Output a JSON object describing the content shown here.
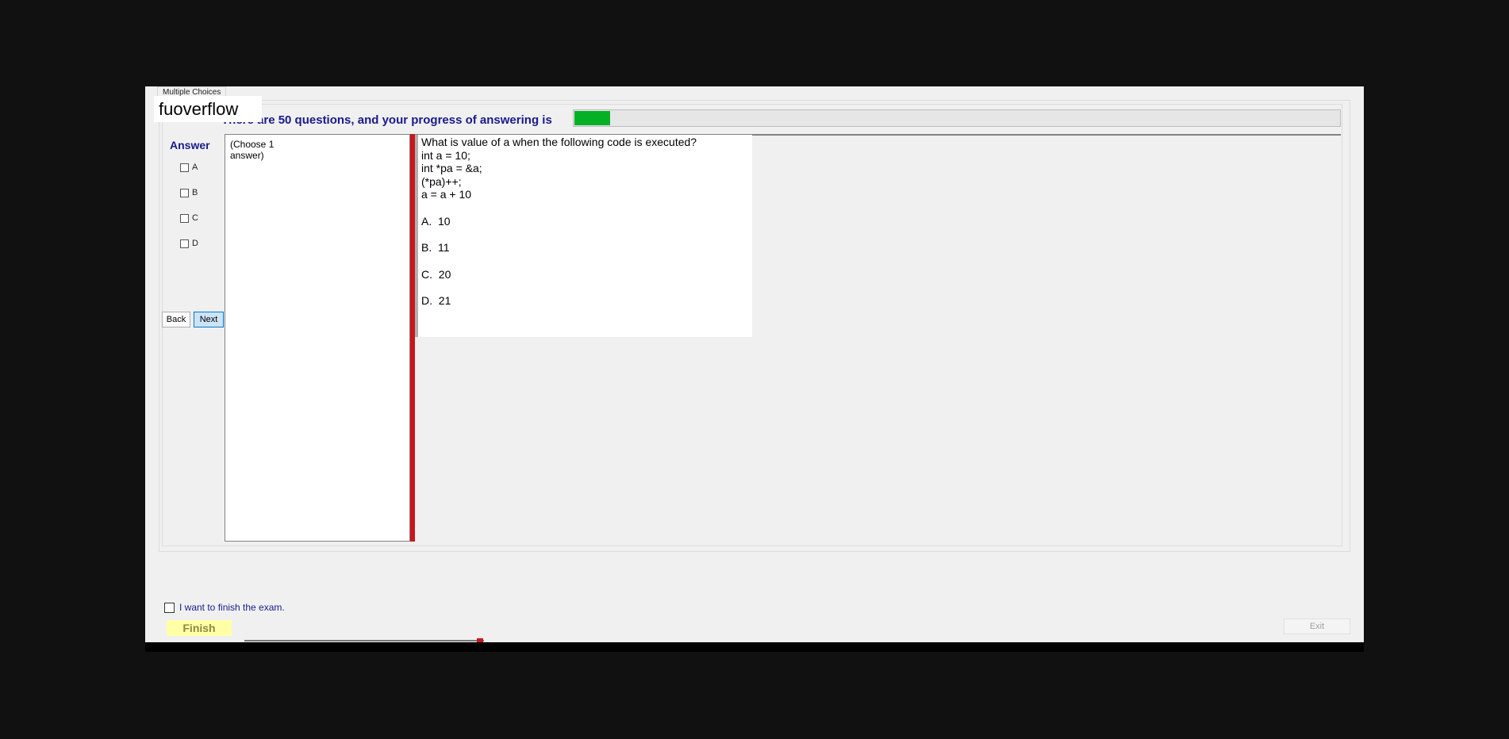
{
  "tab": {
    "label": "Multiple Choices"
  },
  "watermark": "fuoverflow",
  "header": {
    "text": "There are 50 questions, and your progress of answering is",
    "progress_fraction": 0.047,
    "progress_color": "#06b025"
  },
  "answer": {
    "title": "Answer",
    "options": [
      "A",
      "B",
      "C",
      "D"
    ]
  },
  "nav": {
    "back_label": "Back",
    "next_label": "Next"
  },
  "choose_panel": {
    "line1": "(Choose 1",
    "line2": "answer)"
  },
  "question": {
    "lines": [
      "What is value of a when the following code is executed?",
      "int a = 10;",
      "int *pa = &a;",
      "(*pa)++;",
      "a = a + 10"
    ],
    "options": [
      "A.  10",
      "B.  11",
      "C.  20",
      "D.  21"
    ]
  },
  "footer": {
    "finish_checkbox_label": "I want to finish the exam.",
    "finish_label": "Finish",
    "exit_label": "Exit"
  },
  "colors": {
    "splitter": "#c8161c",
    "heading": "#1a1a8c",
    "finish_bg": "#ffffa6"
  }
}
